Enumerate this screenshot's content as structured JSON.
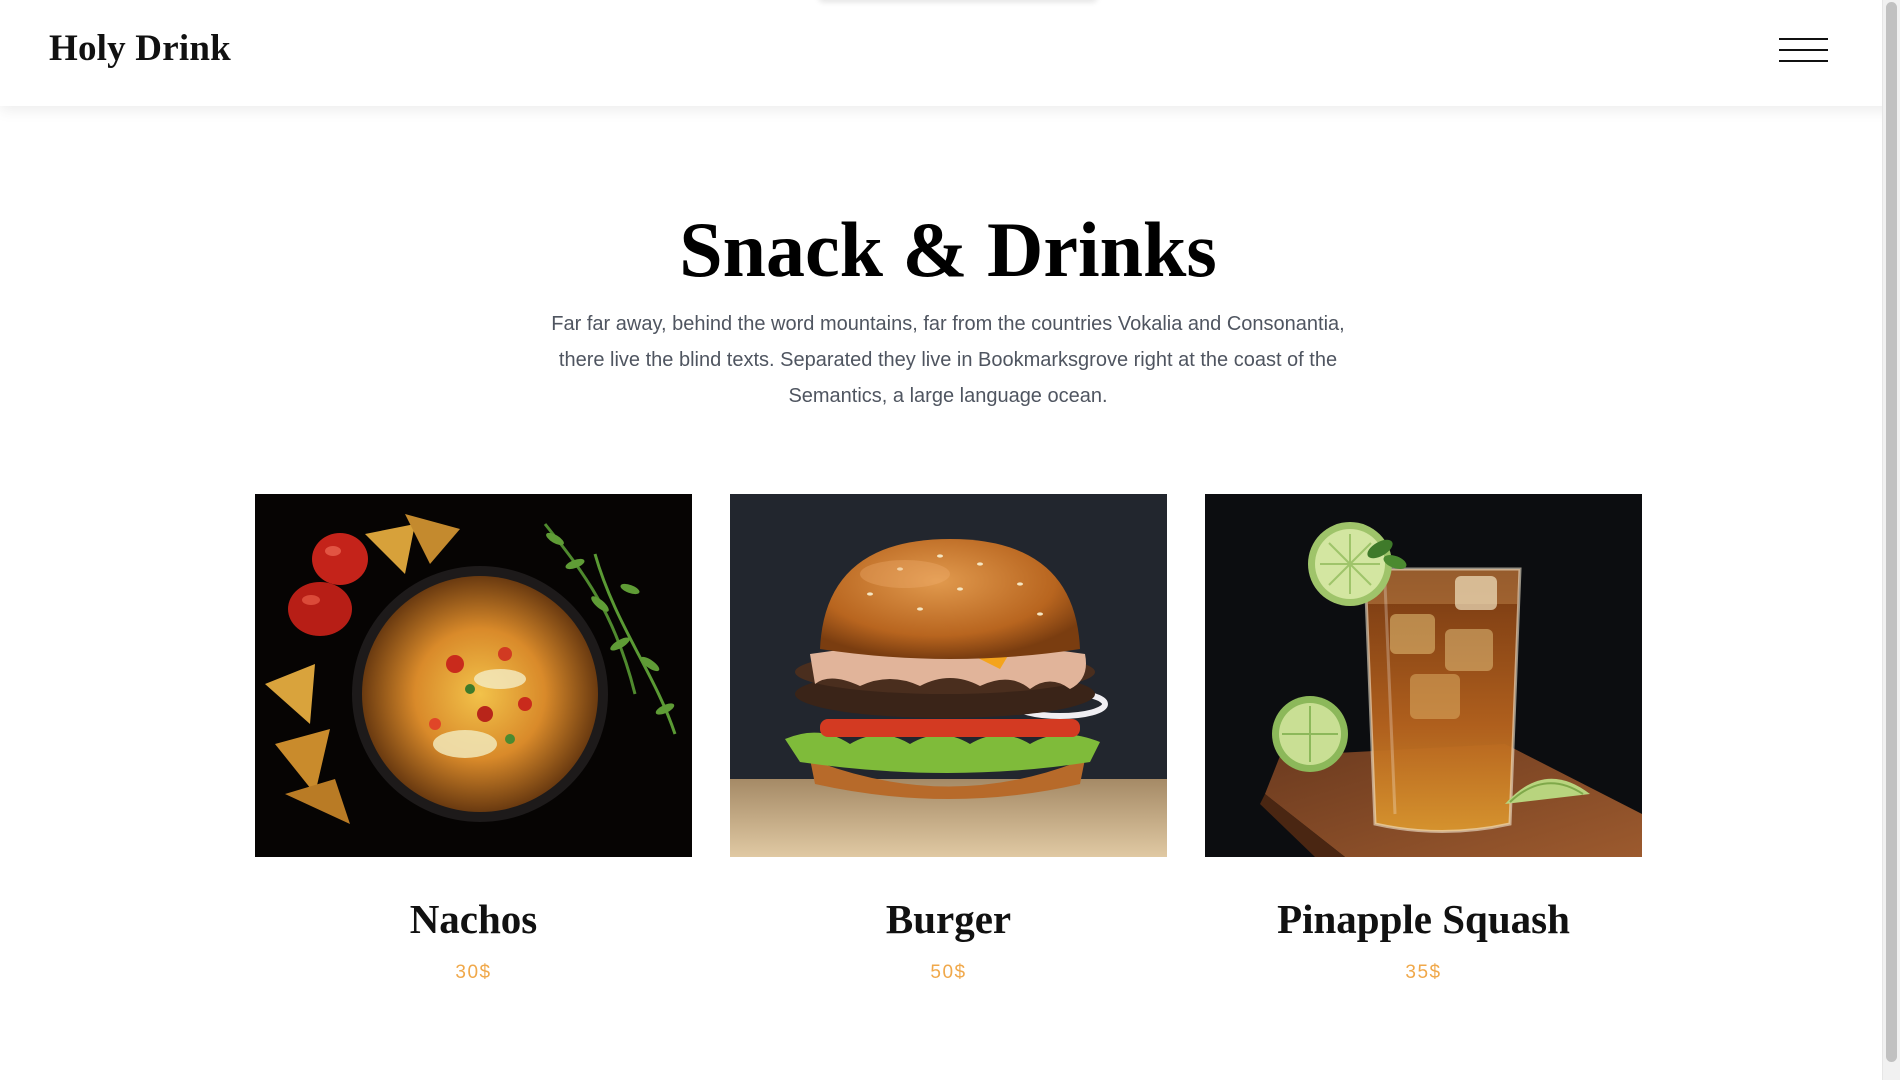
{
  "header": {
    "brand": "Holy Drink",
    "menu_icon": "hamburger-icon"
  },
  "section": {
    "title": "Snack & Drinks",
    "description": "Far far away, behind the word mountains, far from the countries Vokalia and Consonantia, there live the blind texts. Separated they live in Bookmarksgrove right at the coast of the Semantics, a large language ocean."
  },
  "items": [
    {
      "name": "Nachos",
      "price": "30$",
      "image": "nachos-photo"
    },
    {
      "name": "Burger",
      "price": "50$",
      "image": "burger-photo"
    },
    {
      "name": "Pinapple Squash",
      "price": "35$",
      "image": "iced-drink-photo"
    }
  ],
  "colors": {
    "price": "#f0a84a",
    "text": "#111111",
    "description": "#4f5560"
  }
}
